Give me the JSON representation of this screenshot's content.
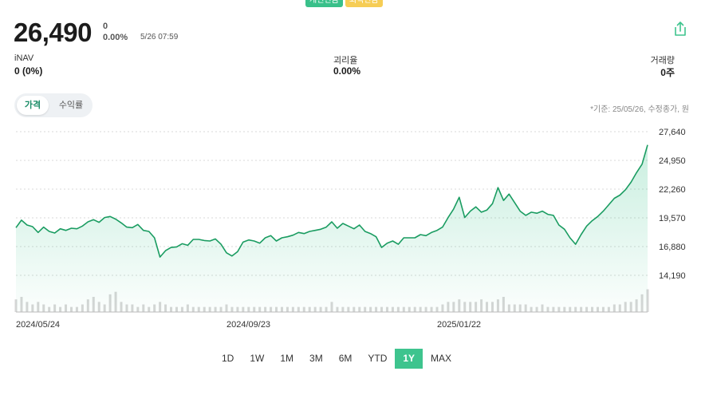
{
  "badges": [
    {
      "label": "개인연금",
      "color": "#39c08a"
    },
    {
      "label": "퇴직연금",
      "color": "#f6cd55"
    }
  ],
  "quote": {
    "price": "26,490",
    "change_abs": "0",
    "change_pct": "0.00%",
    "timestamp": "5/26 07:59"
  },
  "share_icon": "share-icon",
  "stats": {
    "inav": {
      "label": "iNAV",
      "value": "0 (0%)"
    },
    "premium": {
      "label": "괴리율",
      "value": "0.00%"
    },
    "volume": {
      "label": "거래량",
      "value": "0주"
    }
  },
  "toggle": {
    "price_label": "가격",
    "return_label": "수익률",
    "active": "price"
  },
  "basis_note": "*기준: 25/05/26, 수정종가, 원",
  "ranges": {
    "items": [
      "1D",
      "1W",
      "1M",
      "3M",
      "6M",
      "YTD",
      "1Y",
      "MAX"
    ],
    "active": "1Y"
  },
  "colors": {
    "line": "#1a9c61",
    "area_top": "#3ec48e",
    "volume": "#d6d6d6",
    "accent": "#3ec48e"
  },
  "chart_data": {
    "type": "area",
    "x_start": "2024-05-24",
    "x_end": "2025-05-26",
    "x_tick_labels": [
      "2024/05/24",
      "2024/09/23",
      "2025/01/22"
    ],
    "y_tick_labels": [
      "27,640",
      "24,950",
      "22,260",
      "19,570",
      "16,880",
      "14,190"
    ],
    "ylim": [
      14190,
      27640
    ],
    "y_ticks": [
      27640,
      24950,
      22260,
      19570,
      16880,
      14190
    ],
    "grid": true,
    "series": [
      {
        "values": [
          18650,
          19350,
          18900,
          18750,
          18200,
          18700,
          18300,
          18150,
          18550,
          18400,
          18600,
          18550,
          18800,
          19200,
          19400,
          19150,
          19600,
          19700,
          19450,
          19100,
          18700,
          18650,
          18950,
          18400,
          18300,
          17700,
          15900,
          16500,
          16800,
          16850,
          17150,
          17000,
          17550,
          17550,
          17450,
          17400,
          17600,
          17100,
          16300,
          16000,
          16400,
          17300,
          17500,
          17400,
          17200,
          17700,
          17900,
          17400,
          17700,
          17800,
          17950,
          18200,
          18100,
          18300,
          18400,
          18500,
          18700,
          19200,
          18600,
          19050,
          18800,
          18550,
          18900,
          18300,
          18100,
          17800,
          16800,
          17200,
          17400,
          17100,
          17700,
          17700,
          17700,
          18000,
          17900,
          18200,
          18400,
          18700,
          19600,
          20400,
          21500,
          19600,
          20200,
          20600,
          20100,
          20300,
          20900,
          22400,
          21200,
          21800,
          21000,
          20200,
          19800,
          20100,
          20000,
          20200,
          19900,
          19800,
          18900,
          18500,
          17700,
          17100,
          18000,
          18800,
          19300,
          19700,
          20200,
          20800,
          21400,
          21700,
          22200,
          22900,
          23800,
          24600,
          26400
        ]
      }
    ],
    "volume": {
      "values": [
        5,
        6,
        4,
        3,
        4,
        3,
        2,
        3,
        2,
        3,
        2,
        2,
        3,
        5,
        6,
        4,
        3,
        7,
        8,
        4,
        3,
        3,
        2,
        3,
        2,
        3,
        4,
        3,
        2,
        2,
        2,
        3,
        2,
        2,
        2,
        2,
        2,
        2,
        3,
        2,
        2,
        2,
        2,
        2,
        2,
        2,
        2,
        2,
        2,
        2,
        2,
        2,
        2,
        2,
        2,
        2,
        2,
        4,
        2,
        2,
        2,
        2,
        2,
        2,
        2,
        2,
        2,
        2,
        2,
        2,
        2,
        2,
        2,
        2,
        2,
        2,
        2,
        3,
        4,
        4,
        5,
        4,
        4,
        4,
        5,
        4,
        4,
        5,
        6,
        3,
        3,
        3,
        3,
        2,
        2,
        3,
        2,
        2,
        2,
        2,
        2,
        2,
        2,
        2,
        2,
        2,
        2,
        2,
        3,
        3,
        4,
        4,
        5,
        7,
        9
      ]
    }
  }
}
